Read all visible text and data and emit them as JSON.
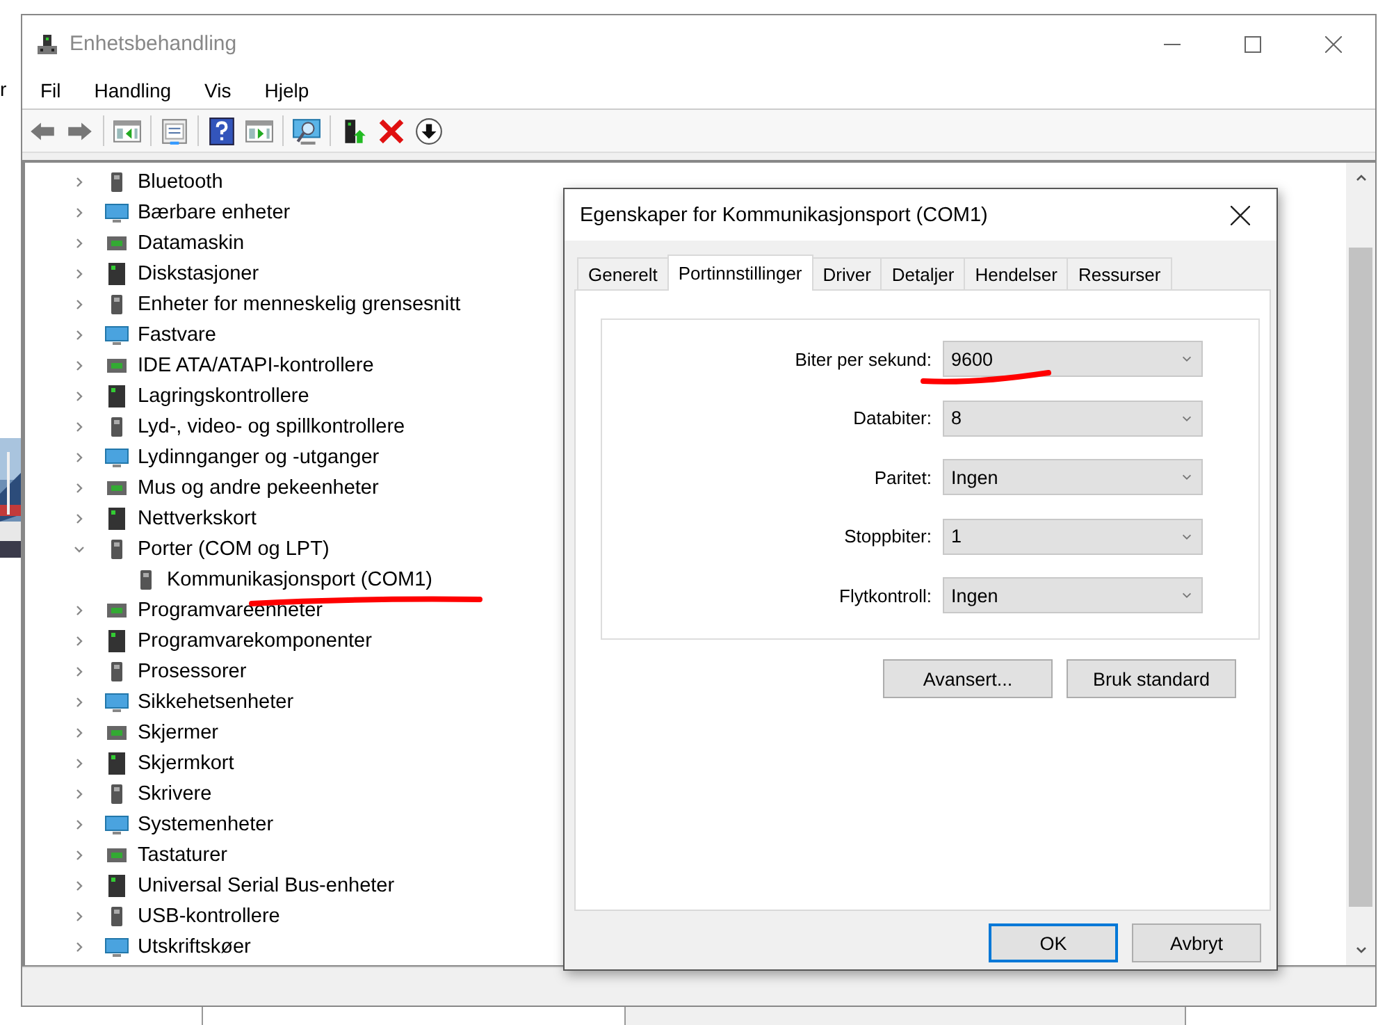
{
  "background": {
    "left_text": "r"
  },
  "window": {
    "title": "Enhetsbehandling"
  },
  "menu": [
    "Fil",
    "Handling",
    "Vis",
    "Hjelp"
  ],
  "toolbar": [
    {
      "kind": "back",
      "disabled": false
    },
    {
      "kind": "forward",
      "disabled": false
    },
    {
      "kind": "sep"
    },
    {
      "kind": "panel"
    },
    {
      "kind": "sep"
    },
    {
      "kind": "properties"
    },
    {
      "kind": "sep"
    },
    {
      "kind": "help"
    },
    {
      "kind": "panel2"
    },
    {
      "kind": "sep"
    },
    {
      "kind": "scan"
    },
    {
      "kind": "sep"
    },
    {
      "kind": "update"
    },
    {
      "kind": "remove"
    },
    {
      "kind": "disable"
    }
  ],
  "tree": [
    {
      "label": "Bluetooth",
      "expanded": false
    },
    {
      "label": "Bærbare enheter",
      "expanded": false
    },
    {
      "label": "Datamaskin",
      "expanded": false
    },
    {
      "label": "Diskstasjoner",
      "expanded": false
    },
    {
      "label": "Enheter for menneskelig grensesnitt",
      "expanded": false
    },
    {
      "label": "Fastvare",
      "expanded": false
    },
    {
      "label": "IDE ATA/ATAPI-kontrollere",
      "expanded": false
    },
    {
      "label": "Lagringskontrollere",
      "expanded": false
    },
    {
      "label": "Lyd-, video- og spillkontrollere",
      "expanded": false
    },
    {
      "label": "Lydinnganger og -utganger",
      "expanded": false
    },
    {
      "label": "Mus og andre pekeenheter",
      "expanded": false
    },
    {
      "label": "Nettverkskort",
      "expanded": false
    },
    {
      "label": "Porter (COM og LPT)",
      "expanded": true,
      "children": [
        {
          "label": "Kommunikasjonsport (COM1)"
        }
      ]
    },
    {
      "label": "Programvareenheter",
      "expanded": false
    },
    {
      "label": "Programvarekomponenter",
      "expanded": false
    },
    {
      "label": "Prosessorer",
      "expanded": false
    },
    {
      "label": "Sikkehetsenheter",
      "expanded": false
    },
    {
      "label": "Skjermer",
      "expanded": false
    },
    {
      "label": "Skjermkort",
      "expanded": false
    },
    {
      "label": "Skrivere",
      "expanded": false
    },
    {
      "label": "Systemenheter",
      "expanded": false
    },
    {
      "label": "Tastaturer",
      "expanded": false
    },
    {
      "label": "Universal Serial Bus-enheter",
      "expanded": false
    },
    {
      "label": "USB-kontrollere",
      "expanded": false
    },
    {
      "label": "Utskriftskøer",
      "expanded": false
    }
  ],
  "dialog": {
    "title": "Egenskaper for Kommunikasjonsport (COM1)",
    "tabs": [
      {
        "label": "Generelt",
        "selected": false
      },
      {
        "label": "Portinnstillinger",
        "selected": true
      },
      {
        "label": "Driver",
        "selected": false
      },
      {
        "label": "Detaljer",
        "selected": false
      },
      {
        "label": "Hendelser",
        "selected": false
      },
      {
        "label": "Ressurser",
        "selected": false
      }
    ],
    "settings": [
      {
        "label": "Biter per sekund:",
        "value": "9600"
      },
      {
        "label": "Databiter:",
        "value": "8"
      },
      {
        "label": "Paritet:",
        "value": "Ingen"
      },
      {
        "label": "Stoppbiter:",
        "value": "1"
      },
      {
        "label": "Flytkontroll:",
        "value": "Ingen"
      }
    ],
    "panel_buttons": [
      "Avansert...",
      "Bruk standard"
    ],
    "buttons": [
      {
        "label": "OK",
        "default": true
      },
      {
        "label": "Avbryt",
        "default": false
      }
    ]
  }
}
